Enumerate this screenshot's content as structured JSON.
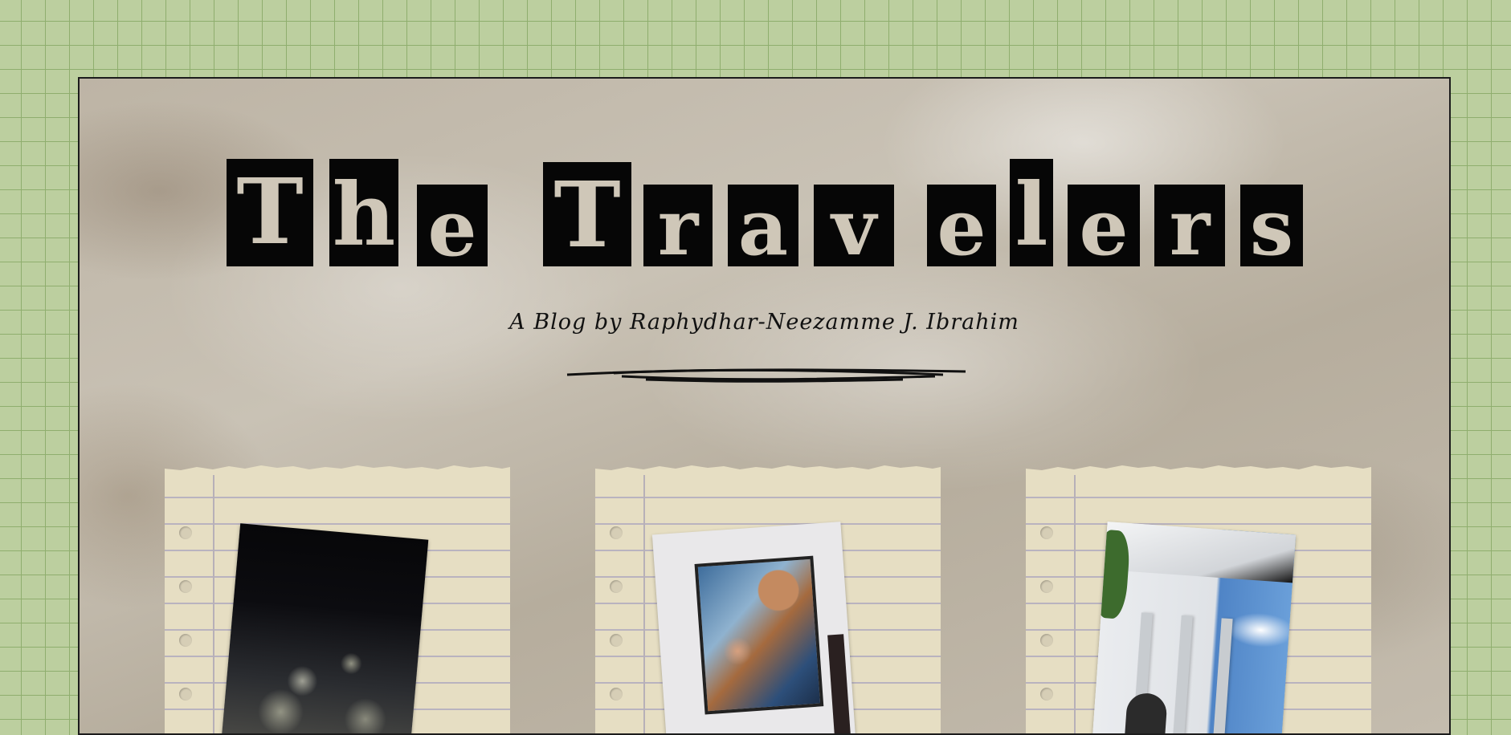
{
  "blog": {
    "title_letters": [
      "T",
      "h",
      "e",
      "T",
      "r",
      "a",
      "v",
      "e",
      "l",
      "e",
      "r",
      "s"
    ],
    "subtitle": "A Blog by Raphydhar-Neezamme J. Ibrahim"
  },
  "cards": [
    {
      "photo": "city-lights-aerial-photo"
    },
    {
      "photo": "framed-poster-photo"
    },
    {
      "photo": "white-building-photo"
    }
  ],
  "colors": {
    "background_grid": "#bccf9f",
    "tile_black": "#060606",
    "tile_letter": "#cfc7b8",
    "notebook_paper": "#e6dec3"
  }
}
